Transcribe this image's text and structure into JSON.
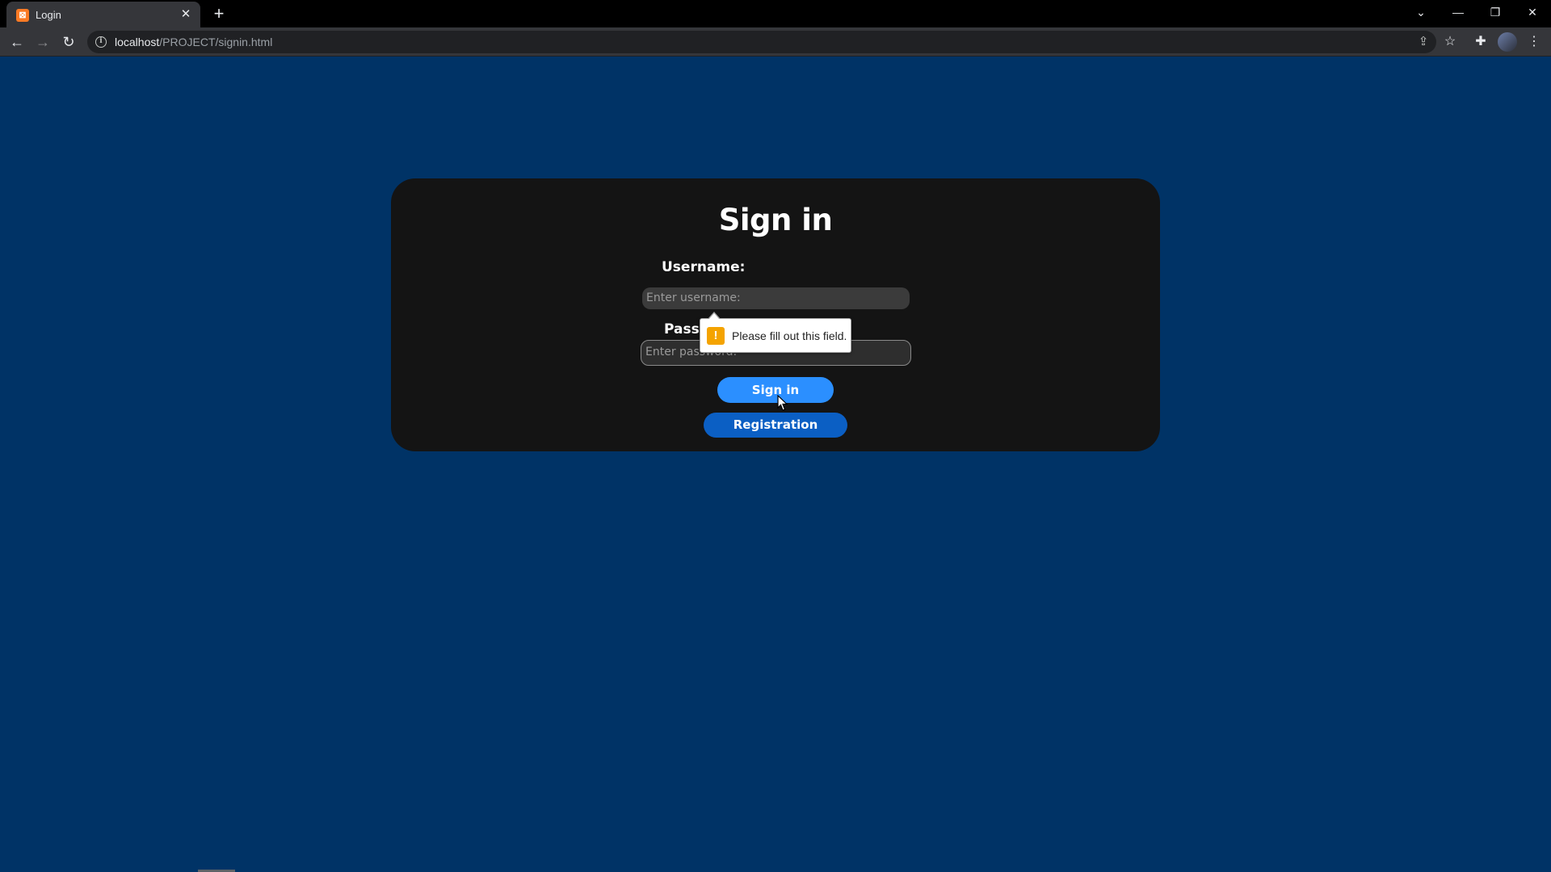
{
  "browser": {
    "tab_title": "Login",
    "tab_favicon": "xampp-favicon-icon",
    "new_tab_symbol": "+",
    "url_host": "localhost",
    "url_path": "/PROJECT/signin.html"
  },
  "page": {
    "title": "Sign in",
    "username_label": "Username:",
    "username_placeholder": "Enter username:",
    "password_label": "Passw",
    "password_placeholder": "Enter password:",
    "signin_button": "Sign in",
    "registration_button": "Registration"
  },
  "validation": {
    "message": "Please fill out this field.",
    "icon": "warning-icon"
  },
  "colors": {
    "background": "#003366",
    "card": "#141414",
    "signin_button": "#2b8fff",
    "registration_button": "#0b5fc4",
    "warning": "#f4a300"
  }
}
